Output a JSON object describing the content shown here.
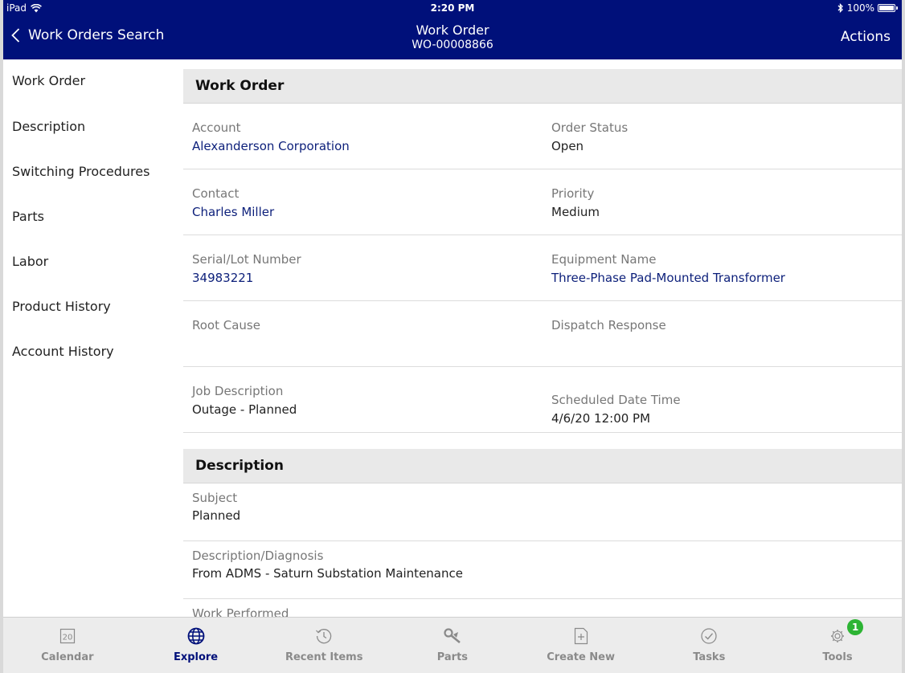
{
  "status_bar": {
    "carrier": "iPad",
    "time": "2:20 PM",
    "battery": "100%"
  },
  "nav": {
    "back_label": "Work Orders Search",
    "title": "Work Order",
    "subtitle": "WO-00008866",
    "actions_label": "Actions"
  },
  "sidebar": {
    "items": [
      {
        "label": "Work Order"
      },
      {
        "label": "Description"
      },
      {
        "label": "Switching Procedures"
      },
      {
        "label": "Parts"
      },
      {
        "label": "Labor"
      },
      {
        "label": "Product History"
      },
      {
        "label": "Account History"
      }
    ]
  },
  "work_order": {
    "header": "Work Order",
    "account": {
      "label": "Account",
      "value": "Alexanderson Corporation"
    },
    "order_status": {
      "label": "Order Status",
      "value": "Open"
    },
    "contact": {
      "label": "Contact",
      "value": "Charles Miller"
    },
    "priority": {
      "label": "Priority",
      "value": "Medium"
    },
    "serial": {
      "label": "Serial/Lot Number",
      "value": "34983221"
    },
    "equipment": {
      "label": "Equipment Name",
      "value": "Three-Phase Pad-Mounted Transformer"
    },
    "root_cause": {
      "label": "Root Cause",
      "value": ""
    },
    "dispatch_response": {
      "label": "Dispatch Response",
      "value": ""
    },
    "job_description": {
      "label": "Job Description",
      "value": "Outage - Planned"
    },
    "scheduled": {
      "label": "Scheduled Date Time",
      "value": "4/6/20 12:00 PM"
    }
  },
  "description": {
    "header": "Description",
    "subject": {
      "label": "Subject",
      "value": "Planned"
    },
    "diagnosis": {
      "label": "Description/Diagnosis",
      "value": "From ADMS - Saturn Substation Maintenance"
    },
    "work_performed": {
      "label": "Work Performed",
      "value": ""
    }
  },
  "tabbar": {
    "tabs": [
      {
        "label": "Calendar",
        "icon": "calendar-icon",
        "icon_text": "20"
      },
      {
        "label": "Explore",
        "icon": "globe-icon"
      },
      {
        "label": "Recent Items",
        "icon": "clock-icon"
      },
      {
        "label": "Parts",
        "icon": "parts-icon"
      },
      {
        "label": "Create New",
        "icon": "create-new-icon"
      },
      {
        "label": "Tasks",
        "icon": "check-circle-icon"
      },
      {
        "label": "Tools",
        "icon": "gear-icon",
        "badge": "1"
      }
    ],
    "active": "Explore"
  },
  "colors": {
    "nav_bar": "#00107a",
    "link": "#0c1f7a",
    "badge": "#2db434",
    "section_header_bg": "#e9e9e9"
  }
}
